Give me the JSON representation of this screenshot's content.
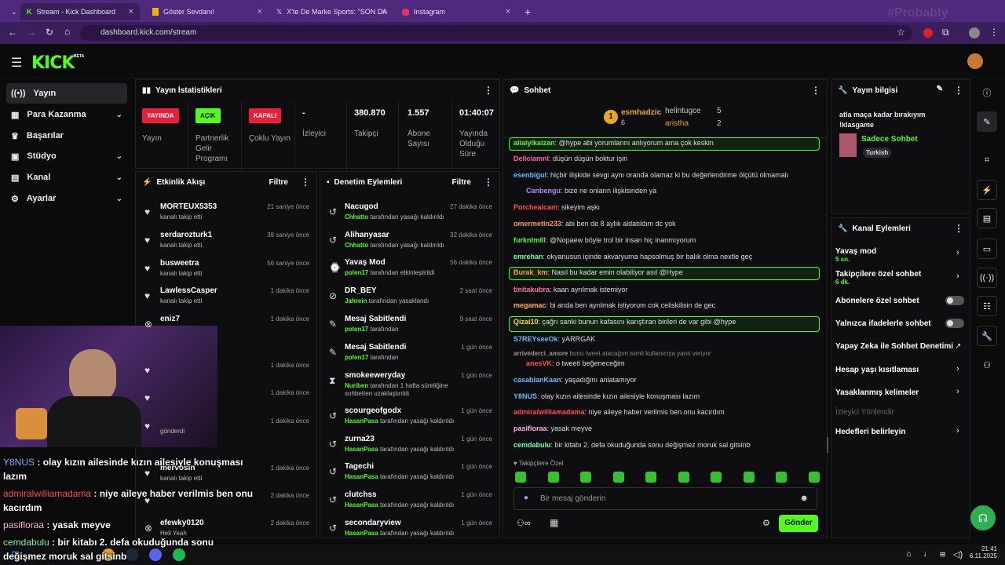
{
  "browser": {
    "tabs": [
      "Stream - Kick Dashboard",
      "Göster Sevdanı!",
      "X'te De Marke Sports: \"SON DA",
      "Instagram"
    ],
    "url": "dashboard.kick.com/stream",
    "watermark": "#Probably"
  },
  "brand": {
    "logo": "KICK",
    "beta": "BETA",
    "accent": "#53fc18"
  },
  "sidebar": {
    "items": [
      "Yayın",
      "Para Kazanma",
      "Başarılar",
      "Stüdyo",
      "Kanal",
      "Ayarlar"
    ]
  },
  "stats": {
    "title": "Yayın İstatistikleri",
    "items": [
      {
        "badge": "YAYINDA",
        "label": "Yayın"
      },
      {
        "badge": "AÇIK",
        "label": "Partnerlik Gelir Programı"
      },
      {
        "badge": "KAPALI",
        "label": "Çoklu Yayın"
      },
      {
        "value": "-",
        "label": "İzleyici"
      },
      {
        "value": "380.870",
        "label": "Takipçi"
      },
      {
        "value": "1.557",
        "label": "Abone Sayısı"
      },
      {
        "value": "01:40:07",
        "label": "Yayında Olduğu Süre"
      }
    ]
  },
  "activity": {
    "title": "Etkinlik Akışı",
    "filter": "Filtre",
    "rows": [
      {
        "name": "MORTEUX5353",
        "sub": "kanalı takip etti",
        "time": "21 saniye önce"
      },
      {
        "name": "serdarozturk1",
        "sub": "kanalı takip etti",
        "time": "38 saniye önce"
      },
      {
        "name": "busweetra",
        "sub": "kanalı takip etti",
        "time": "56 saniye önce"
      },
      {
        "name": "LawlessCasper",
        "sub": "kanalı takip etti",
        "time": "1 dakika önce"
      },
      {
        "name": "eniz7",
        "sub": "",
        "time": "1 dakika önce"
      },
      {
        "name": "",
        "sub": "",
        "time": "1 dakika önce"
      },
      {
        "name": "",
        "sub": "",
        "time": "1 dakika önce"
      },
      {
        "name": "",
        "sub": "gönderdi",
        "time": "1 dakika önce"
      },
      {
        "name": "mervosin",
        "sub": "kanalı takip etti",
        "time": "1 dakika önce"
      },
      {
        "name": "",
        "sub": "",
        "time": "2 dakika önce"
      },
      {
        "name": "efewky0120",
        "sub": "Hell Yeah",
        "time": "2 dakika önce"
      }
    ]
  },
  "moderation": {
    "title": "Denetim Eylemleri",
    "filter": "Filtre",
    "rows": [
      {
        "name": "Nacugod",
        "by": "Chhatto",
        "sub": "tarafından yasağı kaldırıldı",
        "time": "27 dakika önce"
      },
      {
        "name": "Alihanyasar",
        "by": "Chhatto",
        "sub": "tarafından yasağı kaldırıldı",
        "time": "32 dakika önce"
      },
      {
        "name": "Yavaş Mod",
        "by": "polen17",
        "sub": "tarafından etkinleştirildi",
        "time": "56 dakika önce"
      },
      {
        "name": "DR_BEY",
        "by": "Jahrein",
        "sub": "tarafından yasaklandı",
        "time": "2 saat önce"
      },
      {
        "name": "Mesaj Sabitlendi",
        "by": "polen17",
        "sub": "tarafından",
        "time": "9 saat önce"
      },
      {
        "name": "Mesaj Sabitlendi",
        "by": "polen17",
        "sub": "tarafından",
        "time": "1 gün önce"
      },
      {
        "name": "smokeeweryday",
        "by": "Nuriben",
        "sub": "tarafından 1 hafta süreliğine sohbetten uzaklaştırıldı",
        "time": "1 gün önce"
      },
      {
        "name": "scourgeofgodx",
        "by": "HasanPasa",
        "sub": "tarafından yasağı kaldırıldı",
        "time": "1 gün önce"
      },
      {
        "name": "zurna23",
        "by": "HasanPasa",
        "sub": "tarafından yasağı kaldırıldı",
        "time": "1 gün önce"
      },
      {
        "name": "Tagechi",
        "by": "HasanPasa",
        "sub": "tarafından yasağı kaldırıldı",
        "time": "1 gün önce"
      },
      {
        "name": "clutchss",
        "by": "HasanPasa",
        "sub": "tarafından yasağı kaldırıldı",
        "time": "1 gün önce"
      },
      {
        "name": "secondaryview",
        "by": "HasanPasa",
        "sub": "tarafından yasağı kaldırıldı",
        "time": "1 gün önce"
      }
    ]
  },
  "chat": {
    "title": "Sohbet",
    "top": [
      {
        "name": "esmhadzic",
        "count": "6"
      },
      {
        "name": "helintugce",
        "count": "5"
      },
      {
        "name": "aristha",
        "count": "2"
      }
    ],
    "messages": [
      {
        "user": "aliaiyikaizan",
        "color": "#53fc18",
        "text": "@hype abi yorumlarını anlıyorum ama çok keskin"
      },
      {
        "user": "Deliciamnl",
        "color": "#ff5fa2",
        "text": "düşün düşün boktur işin"
      },
      {
        "user": "esenbigul",
        "color": "#6fb6ff",
        "text": "hiçbir ilişkide sevgi aynı oranda olamaz ki bu değerlendirme ölçütü olmamalı"
      },
      {
        "user": "Canbengu",
        "color": "#b38cff",
        "text": "bize ne onların ilişkisinden ya"
      },
      {
        "user": "Porchealcam",
        "color": "#ff4d4d",
        "text": "sikeyim aşkı"
      },
      {
        "user": "omermetin233",
        "color": "#ff9a3d",
        "text": "abi ben de 8 aylık aldatıldım dc yok"
      },
      {
        "user": "furkntmlll",
        "color": "#53fc18",
        "text": "@Nopaew böyle trol bir insan hiç inanmıyorum"
      },
      {
        "user": "emrehan",
        "color": "#6fffb0",
        "text": "okyanusun içinde akvaryuma hapsolmuş bir balık olma nextle geç"
      },
      {
        "user": "Burak_km",
        "color": "#ff9a3d",
        "text": "Nasıl bu kadar emin olabiliyor asıl @Hype"
      },
      {
        "user": "tinitakubra",
        "color": "#ff6fa5",
        "text": "kaan ayrılmak istemiyor"
      },
      {
        "user": "megamac",
        "color": "#ffb347",
        "text": "bi anda ben ayrılmak istiyorum cok celiskilisin de gec"
      },
      {
        "user": "Qizai10",
        "color": "#ffd23d",
        "text": "çağrı sanki bunun kafasını karıştıran birileri de var gibi @hype"
      },
      {
        "user": "S7REYseeOk",
        "color": "#6fb6ff",
        "text": "yARRGAK"
      },
      {
        "user": "arrivederci_amore",
        "color": "#999999",
        "text": "bunu tweet atacağım isimli kullanıcıya yanıt veriyor"
      },
      {
        "user": "anesVK",
        "color": "#ff4d4d",
        "text": "o tweeti beğeneceğim"
      },
      {
        "user": "casablanKaan",
        "color": "#6fb6ff",
        "text": "yaşadığını anlatamıyor"
      },
      {
        "user": "Y8NUS",
        "color": "#6fb6ff",
        "text": "olay kızın ailesinde kızın ailesiyle konuşması lazım"
      },
      {
        "user": "admiralwilliamadama",
        "color": "#ff4d4d",
        "text": "niye aileye haber verilmis ben onu kacırdım"
      },
      {
        "user": "pasifloraa",
        "color": "#ffb0e0",
        "text": "yasak meyve"
      },
      {
        "user": "cemdabulu",
        "color": "#6fffb0",
        "text": "bir kitabı 2. defa okuduğunda sonu değişmez moruk sal gitsinb"
      }
    ],
    "followers_only": "Takipçilere Özel",
    "placeholder": "Bir mesaj gönderin",
    "send": "Gönder"
  },
  "stream_info": {
    "title": "Yayın bilgisi",
    "text": "atla maça kadar bırakıyım !klasgame",
    "category": "Sadece Sohbet",
    "tag": "Turkish"
  },
  "channel_actions": {
    "title": "Kanal Eylemleri",
    "items": [
      {
        "label": "Yavaş mod",
        "sub": "5 sn."
      },
      {
        "label": "Takipçilere özel sohbet",
        "sub": "6 dk."
      },
      {
        "label": "Abonelere özel sohbet"
      },
      {
        "label": "Yalnızca ifadelerle sohbet"
      },
      {
        "label": "Yapay Zeka ile Sohbet Denetimi"
      },
      {
        "label": "Hesap yaşı kısıtlaması"
      },
      {
        "label": "Yasaklanmış kelimeler"
      },
      {
        "label": "İzleyici Yönlendir"
      },
      {
        "label": "Hedefleri belirleyin"
      }
    ]
  },
  "overlay": [
    {
      "user": "Y8NUS",
      "color": "#6fb6ff",
      "text": "olay kızın ailesinde kızın ailesiyle konuşması lazım"
    },
    {
      "user": "admiralwilliamadama",
      "color": "#ff4d4d",
      "text": "niye aileye haber verilmis ben onu kacırdım"
    },
    {
      "user": "pasifloraa",
      "color": "#ffb0e0",
      "text": "yasak meyve"
    },
    {
      "user": "cemdabulu",
      "color": "#6fffb0",
      "text": "bir kitabı 2. defa okuduğunda sonu değişmez moruk sal gitsinb"
    }
  ],
  "clock": {
    "time": "21:41",
    "date": "6.11.2025"
  }
}
